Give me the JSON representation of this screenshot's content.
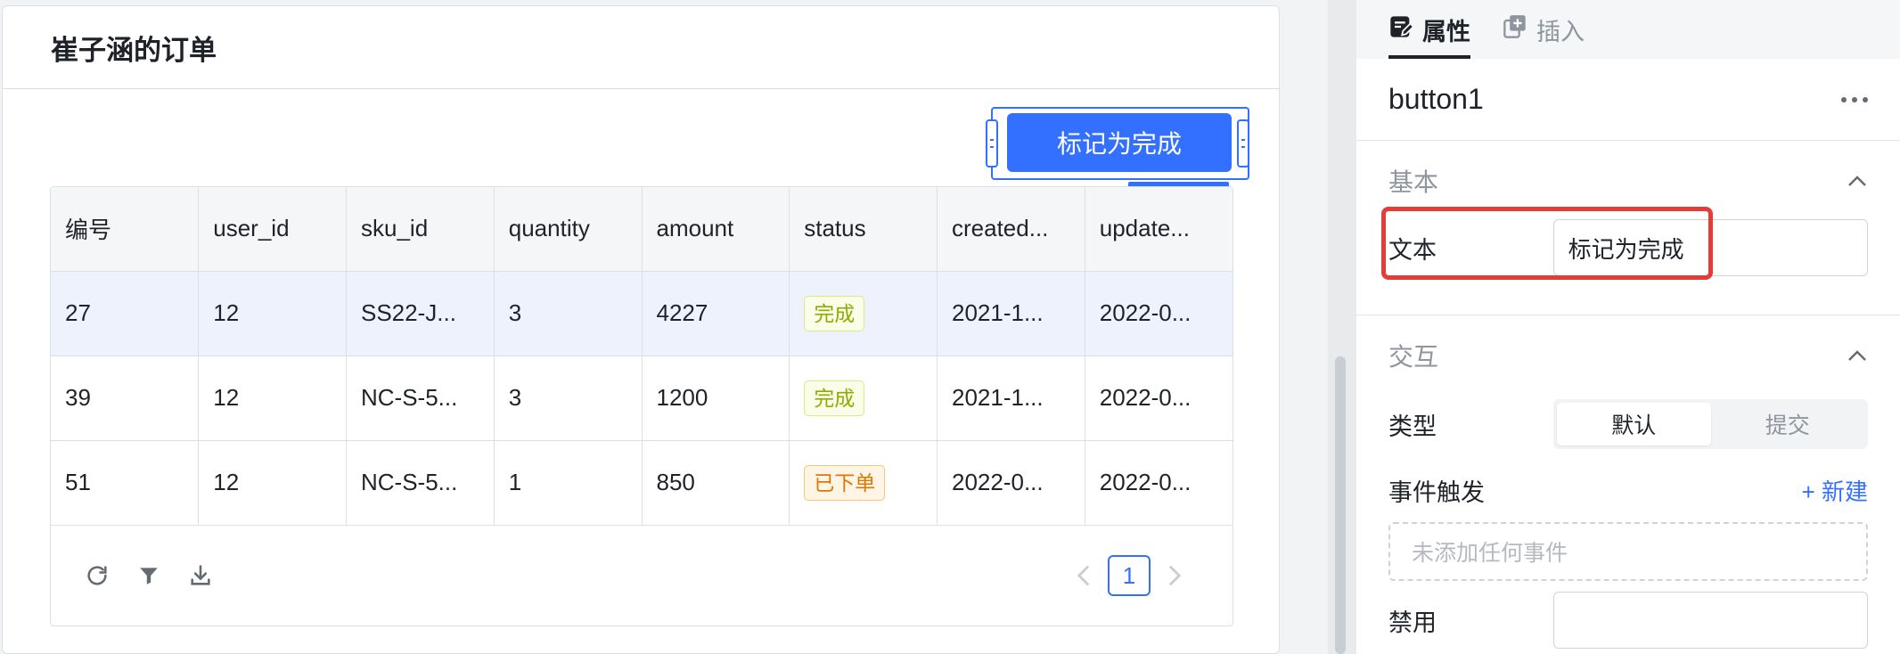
{
  "card": {
    "title": "崔子涵的订单"
  },
  "button": {
    "label": "标记为完成",
    "tag": "button1"
  },
  "table": {
    "columns": [
      "编号",
      "user_id",
      "sku_id",
      "quantity",
      "amount",
      "status",
      "created...",
      "update..."
    ],
    "rows": [
      {
        "id": "27",
        "user_id": "12",
        "sku_id": "SS22-J...",
        "quantity": "3",
        "amount": "4227",
        "status": "完成",
        "status_kind": "done",
        "created": "2021-1...",
        "updated": "2022-0..."
      },
      {
        "id": "39",
        "user_id": "12",
        "sku_id": "NC-S-5...",
        "quantity": "3",
        "amount": "1200",
        "status": "完成",
        "status_kind": "done",
        "created": "2021-1...",
        "updated": "2022-0..."
      },
      {
        "id": "51",
        "user_id": "12",
        "sku_id": "NC-S-5...",
        "quantity": "1",
        "amount": "850",
        "status": "已下单",
        "status_kind": "ordered",
        "created": "2022-0...",
        "updated": "2022-0..."
      }
    ],
    "footer_icons": [
      "refresh-icon",
      "filter-icon",
      "download-icon"
    ],
    "page": "1"
  },
  "panel": {
    "tabs": [
      {
        "label": "属性",
        "icon": "edit-doc-icon",
        "active": true
      },
      {
        "label": "插入",
        "icon": "add-copy-icon",
        "active": false
      }
    ],
    "component_name": "button1",
    "basic": {
      "title": "基本",
      "text_label": "文本",
      "text_value": "标记为完成"
    },
    "interaction": {
      "title": "交互",
      "type_label": "类型",
      "type_options": [
        "默认",
        "提交"
      ],
      "type_selected": "默认",
      "event_label": "事件触发",
      "new_label": "+ 新建",
      "event_empty": "未添加任何事件",
      "disabled_label": "禁用"
    }
  },
  "colors": {
    "accent": "#3370ff",
    "highlight": "#e33c39",
    "done": "#8fac02",
    "ordered": "#de7802"
  }
}
